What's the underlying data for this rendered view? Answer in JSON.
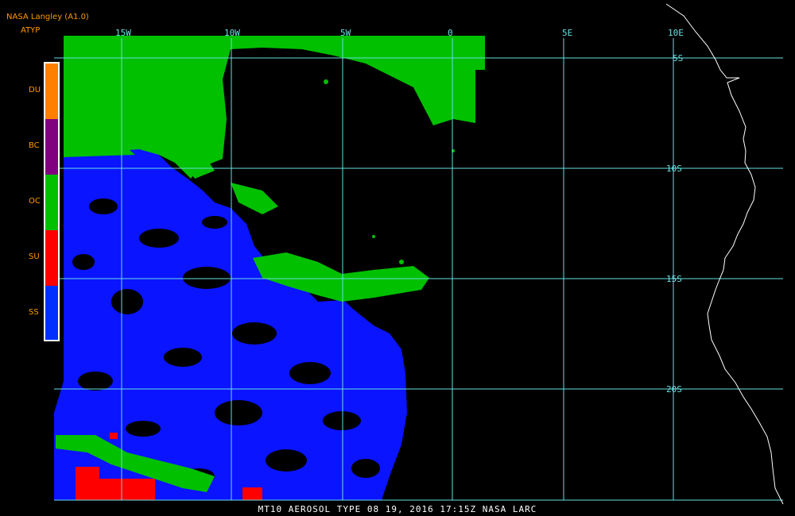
{
  "header": {
    "title": "NASA Langley (A1.0)",
    "product": "ATYP"
  },
  "legend": [
    {
      "label": "DU",
      "color": "#ff8000"
    },
    {
      "label": "BC",
      "color": "#800080"
    },
    {
      "label": "OC",
      "color": "#00c000"
    },
    {
      "label": "SU",
      "color": "#ff0000"
    },
    {
      "label": "SS",
      "color": "#0030ff"
    }
  ],
  "grid": {
    "lon_labels": [
      "15W",
      "10W",
      "5W",
      "0",
      "5E",
      "10E"
    ],
    "lat_labels": [
      "5S",
      "10S",
      "15S",
      "20S"
    ],
    "line_color": "#66e0e0"
  },
  "footer": {
    "text": "MT10  AEROSOL TYPE  08 19, 2016 17:15Z  NASA LARC"
  },
  "colors": {
    "coastline": "#ffffff",
    "background": "#000000"
  }
}
